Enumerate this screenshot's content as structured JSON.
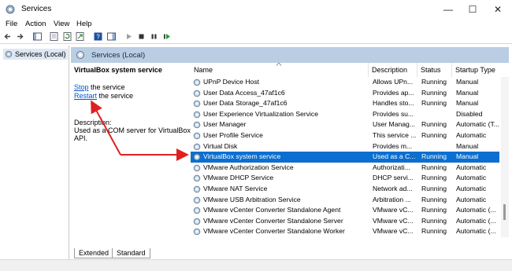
{
  "window": {
    "title": "Services"
  },
  "menu": [
    "File",
    "Action",
    "View",
    "Help"
  ],
  "tree": {
    "root_label": "Services (Local)"
  },
  "header": {
    "title": "Services (Local)"
  },
  "details": {
    "service_name": "VirtualBox system service",
    "stop_link": "Stop",
    "stop_suffix": " the service",
    "restart_link": "Restart",
    "restart_suffix": " the service",
    "description_label": "Description:",
    "description_line1": "Used as a COM server for VirtualBox",
    "description_line2": "API."
  },
  "columns": {
    "name": "Name",
    "description": "Description",
    "status": "Status",
    "startup": "Startup Type"
  },
  "rows": [
    {
      "name": "UPnP Device Host",
      "description": "Allows UPn...",
      "status": "Running",
      "startup": "Manual"
    },
    {
      "name": "User Data Access_47af1c6",
      "description": "Provides ap...",
      "status": "Running",
      "startup": "Manual"
    },
    {
      "name": "User Data Storage_47af1c6",
      "description": "Handles sto...",
      "status": "Running",
      "startup": "Manual"
    },
    {
      "name": "User Experience Virtualization Service",
      "description": "Provides su...",
      "status": "",
      "startup": "Disabled"
    },
    {
      "name": "User Manager",
      "description": "User Manag...",
      "status": "Running",
      "startup": "Automatic (T..."
    },
    {
      "name": "User Profile Service",
      "description": "This service ...",
      "status": "Running",
      "startup": "Automatic"
    },
    {
      "name": "Virtual Disk",
      "description": "Provides m...",
      "status": "",
      "startup": "Manual"
    },
    {
      "name": "VirtualBox system service",
      "description": "Used as a C...",
      "status": "Running",
      "startup": "Manual"
    },
    {
      "name": "VMware Authorization Service",
      "description": "Authorizati...",
      "status": "Running",
      "startup": "Automatic"
    },
    {
      "name": "VMware DHCP Service",
      "description": "DHCP servi...",
      "status": "Running",
      "startup": "Automatic"
    },
    {
      "name": "VMware NAT Service",
      "description": "Network ad...",
      "status": "Running",
      "startup": "Automatic"
    },
    {
      "name": "VMware USB Arbitration Service",
      "description": "Arbitration ...",
      "status": "Running",
      "startup": "Automatic"
    },
    {
      "name": "VMware vCenter Converter Standalone Agent",
      "description": "VMware vC...",
      "status": "Running",
      "startup": "Automatic (..."
    },
    {
      "name": "VMware vCenter Converter Standalone Server",
      "description": "VMware vC...",
      "status": "Running",
      "startup": "Automatic (..."
    },
    {
      "name": "VMware vCenter Converter Standalone Worker",
      "description": "VMware vC...",
      "status": "Running",
      "startup": "Automatic (..."
    }
  ],
  "selected_row": 7,
  "tabs": [
    "Extended",
    "Standard"
  ],
  "colors": {
    "selection": "#0a6fd0",
    "header_bar": "#b9cde3",
    "annotation_arrow": "#e02020",
    "link": "#0055cc"
  }
}
